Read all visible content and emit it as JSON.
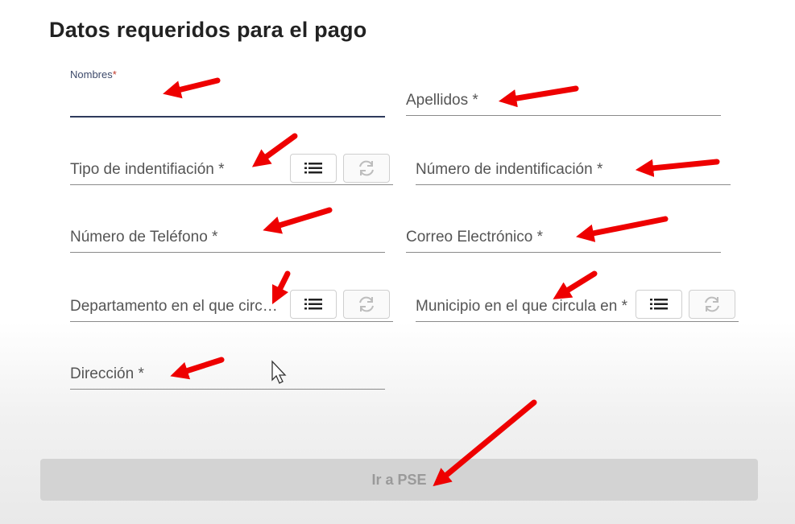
{
  "title": "Datos requeridos para el pago",
  "fields": {
    "nombres": {
      "label": "Nombres",
      "required_mark": "*"
    },
    "apellidos": {
      "label": "Apellidos *"
    },
    "tipo_id": {
      "label": "Tipo de indentifiación *"
    },
    "numero_id": {
      "label": "Número de indentificación *"
    },
    "telefono": {
      "label": "Número de Teléfono *"
    },
    "correo": {
      "label": "Correo Electrónico *"
    },
    "departamento": {
      "label": "Departamento en el que circula *"
    },
    "municipio": {
      "label": "Municipio en el que circula en *"
    },
    "direccion": {
      "label": "Dirección *"
    }
  },
  "submit_label": "Ir a PSE",
  "icons": [
    "list-icon",
    "refresh-icon",
    "mouse-cursor-icon",
    "red-arrow-annotation"
  ],
  "colors": {
    "accent": "#2e3a5c",
    "arrow": "#ee0000",
    "button_bg": "#d3d3d3"
  }
}
